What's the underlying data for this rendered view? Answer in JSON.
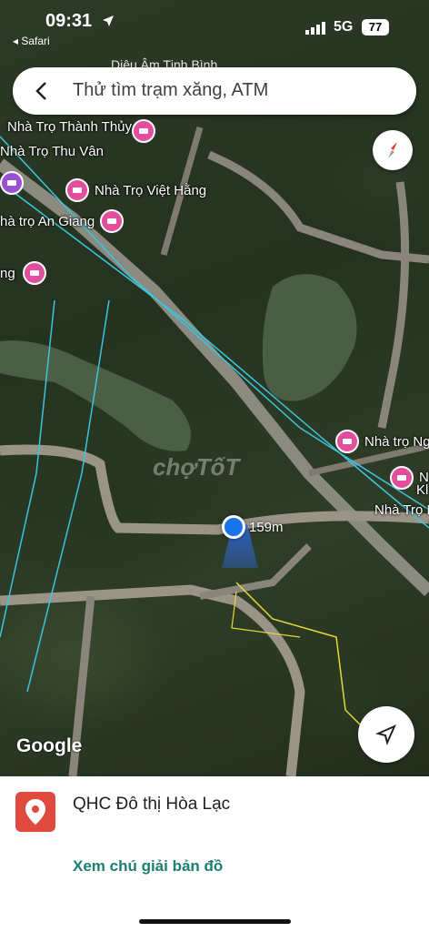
{
  "status_bar": {
    "time": "09:31",
    "back_app": "◂ Safari",
    "network": "5G",
    "battery": "77"
  },
  "search": {
    "placeholder": "Thử tìm trạm xăng, ATM"
  },
  "map": {
    "faded_label": "Diệu Âm Tịnh Bình",
    "pois": [
      {
        "label": "Nhà Trọ Thành Thủy"
      },
      {
        "label": "Nhà Trọ Thu Vân"
      },
      {
        "label": "Nhà Trọ Việt Hằng"
      },
      {
        "label": "hà trọ An Giang"
      },
      {
        "label": "ng"
      },
      {
        "label": "Nhà trọ Ng"
      },
      {
        "label": "N"
      },
      {
        "label": "Kl"
      },
      {
        "label": "Nhà Trọ K"
      }
    ],
    "distance": "159m",
    "watermark": "chợTốT",
    "attribution": "Google"
  },
  "sheet": {
    "place_name": "QHC Đô thị Hòa Lạc",
    "legend_link": "Xem chú giải bản đồ"
  }
}
